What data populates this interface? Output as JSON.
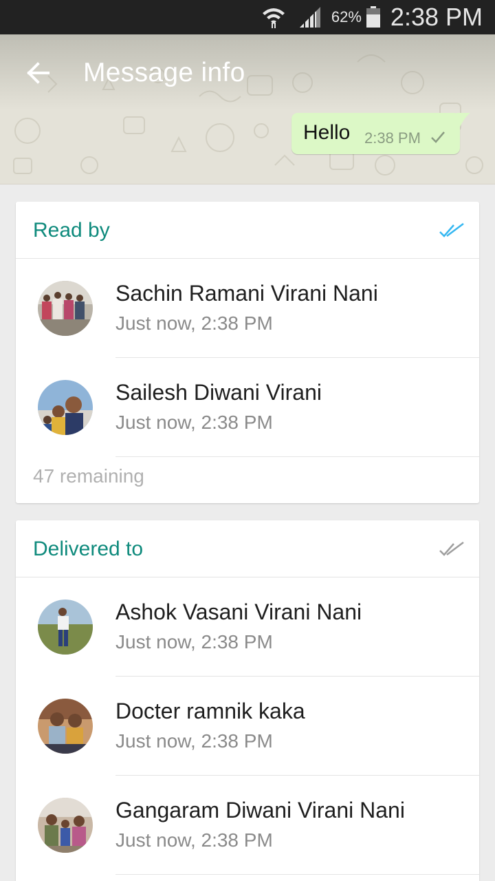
{
  "status_bar": {
    "battery": "62%",
    "time": "2:38 PM"
  },
  "header": {
    "title": "Message info",
    "back_icon": "arrow-back-icon"
  },
  "message": {
    "text": "Hello",
    "time": "2:38 PM",
    "status": "sent-check-icon"
  },
  "read_by": {
    "title": "Read by",
    "tick_color": "#34b7f1",
    "contacts": [
      {
        "name": "Sachin Ramani Virani Nani",
        "time": "Just now, 2:38 PM"
      },
      {
        "name": "Sailesh Diwani Virani",
        "time": "Just now, 2:38 PM"
      }
    ],
    "remaining": "47 remaining"
  },
  "delivered_to": {
    "title": "Delivered to",
    "tick_color": "#9e9e9e",
    "contacts": [
      {
        "name": "Ashok Vasani Virani Nani",
        "time": "Just now, 2:38 PM"
      },
      {
        "name": "Docter ramnik kaka",
        "time": "Just now, 2:38 PM"
      },
      {
        "name": "Gangaram Diwani Virani Nani",
        "time": "Just now, 2:38 PM"
      }
    ]
  },
  "colors": {
    "accent": "#0e8a7c",
    "bubble": "#dcf8c6"
  }
}
